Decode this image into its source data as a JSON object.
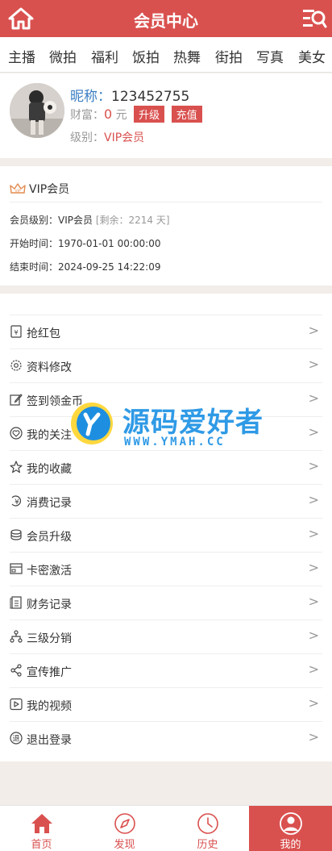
{
  "header": {
    "title": "会员中心"
  },
  "tabs": [
    "主播",
    "微拍",
    "福利",
    "饭拍",
    "热舞",
    "街拍",
    "写真",
    "美女"
  ],
  "profile": {
    "name_label": "昵称：",
    "name_value": "123452755",
    "wealth_label": "财富：",
    "wealth_amount": "0",
    "wealth_unit": "元",
    "upgrade_label": "升级",
    "recharge_label": "充值",
    "level_label": "级别：",
    "level_value": "VIP会员"
  },
  "vip": {
    "title": "VIP会员",
    "level_label": "会员级别：",
    "level_value": "VIP会员",
    "remaining": "[剩余：2214 天]",
    "start_label": "开始时间：",
    "start_value": "1970-01-01 00:00:00",
    "end_label": "结束时间：",
    "end_value": "2024-09-25 14:22:09"
  },
  "menu": [
    {
      "label": "抢红包",
      "icon": "red-packet-icon"
    },
    {
      "label": "资料修改",
      "icon": "gear-icon"
    },
    {
      "label": "签到领金币",
      "icon": "edit-icon"
    },
    {
      "label": "我的关注",
      "icon": "heart-icon"
    },
    {
      "label": "我的收藏",
      "icon": "star-icon"
    },
    {
      "label": "消费记录",
      "icon": "yen-icon"
    },
    {
      "label": "会员升级",
      "icon": "coins-icon"
    },
    {
      "label": "卡密激活",
      "icon": "card-icon"
    },
    {
      "label": "财务记录",
      "icon": "document-icon"
    },
    {
      "label": "三级分销",
      "icon": "hierarchy-icon"
    },
    {
      "label": "宣传推广",
      "icon": "share-icon"
    },
    {
      "label": "我的视频",
      "icon": "play-icon"
    },
    {
      "label": "退出登录",
      "icon": "logout-icon"
    }
  ],
  "arrow_glyph": ">",
  "watermark": {
    "name": "源码爱好者",
    "url": "WWW.YMAH.CC"
  },
  "bottom_nav": [
    {
      "label": "首页",
      "icon": "home-icon"
    },
    {
      "label": "发现",
      "icon": "compass-icon"
    },
    {
      "label": "历史",
      "icon": "clock-icon"
    },
    {
      "label": "我的",
      "icon": "user-icon"
    }
  ],
  "colors": {
    "brand": "#d9514f",
    "link": "#3a7ec3",
    "background": "#f2ede8"
  }
}
